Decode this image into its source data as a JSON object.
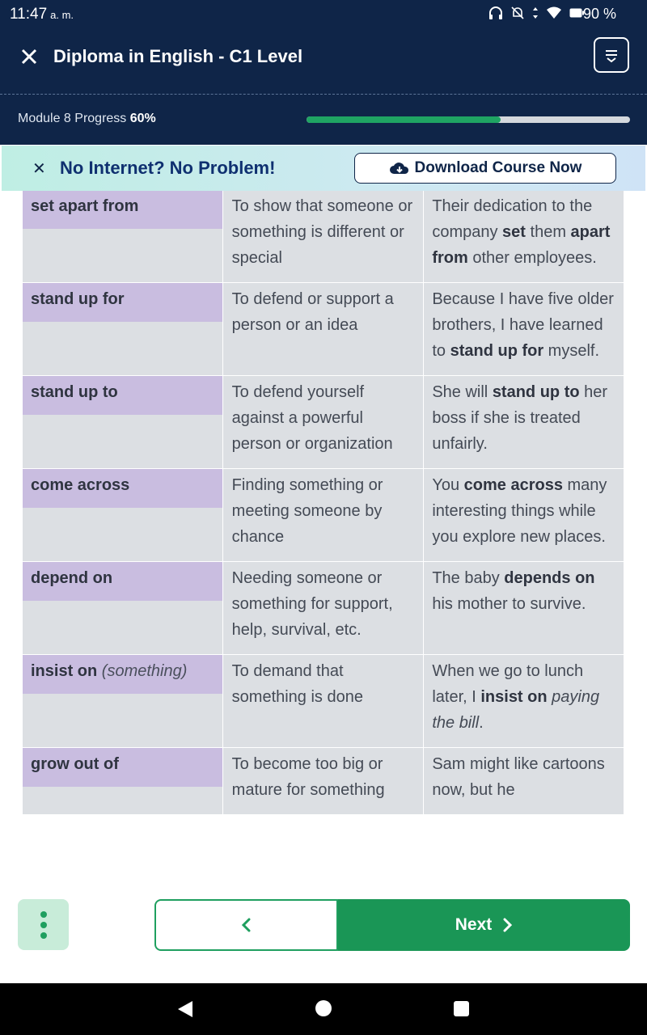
{
  "status_bar": {
    "time": "11:47",
    "ampm": "a. m.",
    "battery": "90 %"
  },
  "header": {
    "title": "Diploma in English - C1 Level",
    "progress_label": "Module 8 Progress",
    "progress_value": "60%",
    "progress_fraction": 0.6
  },
  "banner": {
    "text": "No Internet? No Problem!",
    "button_label": "Download Course Now"
  },
  "table": {
    "rows": [
      {
        "term": "set apart from",
        "term_note": "",
        "meaning": "To show that someone or something is different or special",
        "example": [
          {
            "t": "Their dedication to the company "
          },
          {
            "t": "set",
            "b": true
          },
          {
            "t": " them "
          },
          {
            "t": "apart from",
            "b": true
          },
          {
            "t": " other employees."
          }
        ]
      },
      {
        "term": "stand up for",
        "term_note": "",
        "meaning": "To defend or support a person or an idea",
        "example": [
          {
            "t": "Because I have five older brothers, I have learned to "
          },
          {
            "t": "stand up for",
            "b": true
          },
          {
            "t": " myself."
          }
        ]
      },
      {
        "term": "stand up to",
        "term_note": "",
        "meaning": "To defend yourself against a powerful person or organization",
        "example": [
          {
            "t": "She will "
          },
          {
            "t": "stand up to",
            "b": true
          },
          {
            "t": " her boss if she is treated unfairly."
          }
        ]
      },
      {
        "term": "come across",
        "term_note": "",
        "meaning": "Finding something or meeting  someone by chance",
        "example": [
          {
            "t": "You "
          },
          {
            "t": "come across",
            "b": true
          },
          {
            "t": " many interesting things while you explore new places."
          }
        ]
      },
      {
        "term": "depend on",
        "term_note": "",
        "meaning": "Needing someone or something for support, help, survival, etc.",
        "example": [
          {
            "t": "The baby "
          },
          {
            "t": "depends on",
            "b": true
          },
          {
            "t": " his mother to survive."
          }
        ]
      },
      {
        "term": "insist on",
        "term_note": "(something)",
        "meaning": "To demand that something is done",
        "example": [
          {
            "t": "When we go to lunch later, I "
          },
          {
            "t": "insist on",
            "b": true
          },
          {
            "t": " "
          },
          {
            "t": "paying the bill",
            "i": true
          },
          {
            "t": "."
          }
        ]
      },
      {
        "term": "grow out of",
        "term_note": "",
        "meaning": "To become too big or mature for something",
        "example": [
          {
            "t": "Sam might like cartoons now, but he"
          }
        ]
      }
    ]
  },
  "bottom_nav": {
    "prev_symbol": "‹",
    "next_label": "Next"
  },
  "icons": {
    "close": "close-icon",
    "menu": "menu-icon",
    "download": "cloud-download-icon",
    "more": "more-vertical-icon",
    "prev": "chevron-left-icon",
    "next": "chevron-right-icon"
  },
  "colors": {
    "header_bg": "#0f2548",
    "accent_green": "#1a9656",
    "term_bg": "#c9bde0",
    "cell_bg": "#dcdfe3"
  }
}
